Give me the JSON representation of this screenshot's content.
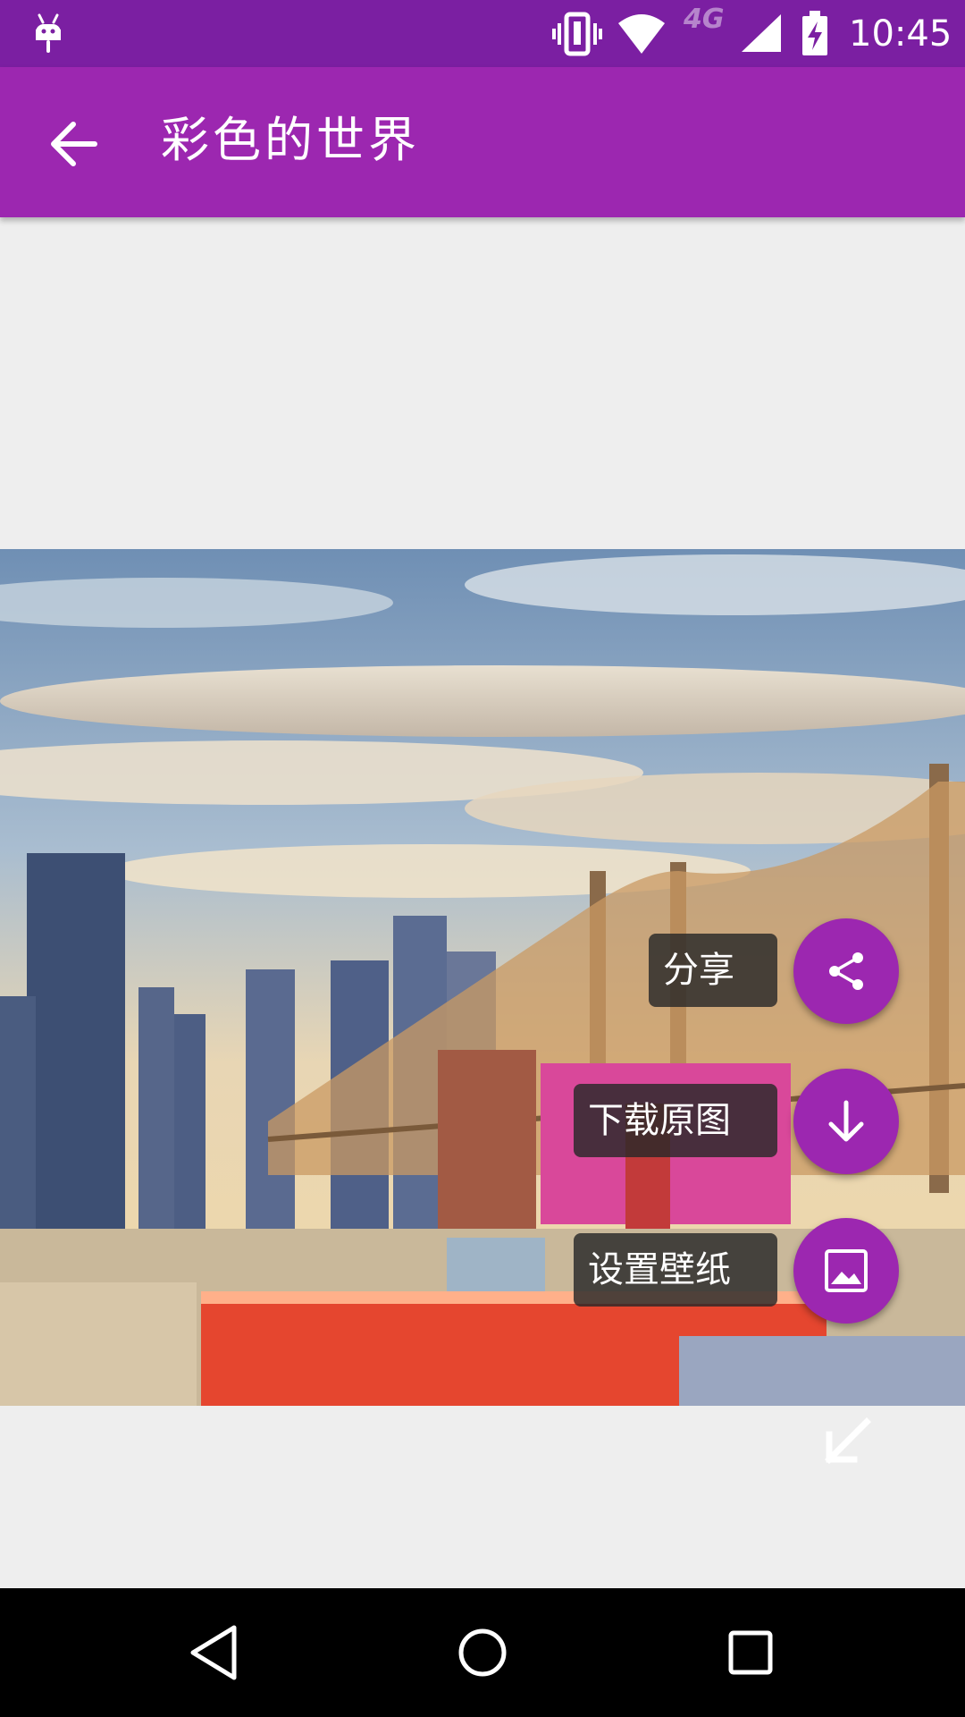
{
  "status_bar": {
    "network_label": "4G",
    "time": "10:45",
    "icons": [
      "android-icon",
      "vibrate-icon",
      "wifi-icon",
      "signal-icon",
      "battery-charging-icon"
    ]
  },
  "toolbar": {
    "title": "彩色的世界",
    "back_icon": "arrow-left-icon"
  },
  "photo": {
    "description_icon": "city-skyline-image"
  },
  "fab_menu": {
    "share_label": "分享",
    "download_label": "下载原图",
    "wallpaper_label": "设置壁纸",
    "share_icon": "share-icon",
    "download_icon": "arrow-down-icon",
    "wallpaper_icon": "image-icon",
    "collapse_icon": "arrow-down-left-icon"
  },
  "colors": {
    "status_bar": "#7b1fa2",
    "primary": "#9c27b0",
    "background": "#eeeeee",
    "nav_bar": "#000000"
  }
}
